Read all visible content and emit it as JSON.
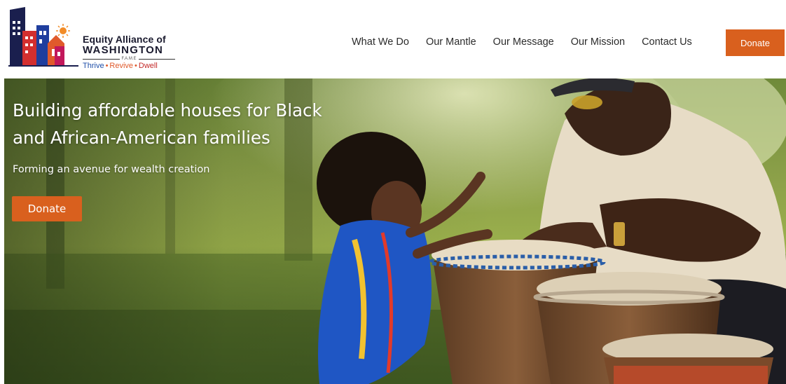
{
  "brand": {
    "name_line1": "Equity Alliance of",
    "name_line2": "WASHINGTON",
    "acronym": "F.A.M.E",
    "tagline_thrive": "Thrive",
    "tagline_revive": "Revive",
    "tagline_dwell": "Dwell",
    "colors": {
      "navy": "#1a1f4e",
      "red": "#d32f2f",
      "orange": "#e05a2b",
      "blue": "#1f4fa8"
    }
  },
  "nav": {
    "items": [
      {
        "label": "What We Do"
      },
      {
        "label": "Our Mantle"
      },
      {
        "label": "Our Message"
      },
      {
        "label": "Our Mission"
      },
      {
        "label": "Contact Us"
      }
    ],
    "donate_label": "Donate"
  },
  "hero": {
    "title": "Building affordable houses for Black and African-American families",
    "subtitle": "Forming an avenue for wealth creation",
    "cta_label": "Donate"
  },
  "accent_color": "#d9601e"
}
